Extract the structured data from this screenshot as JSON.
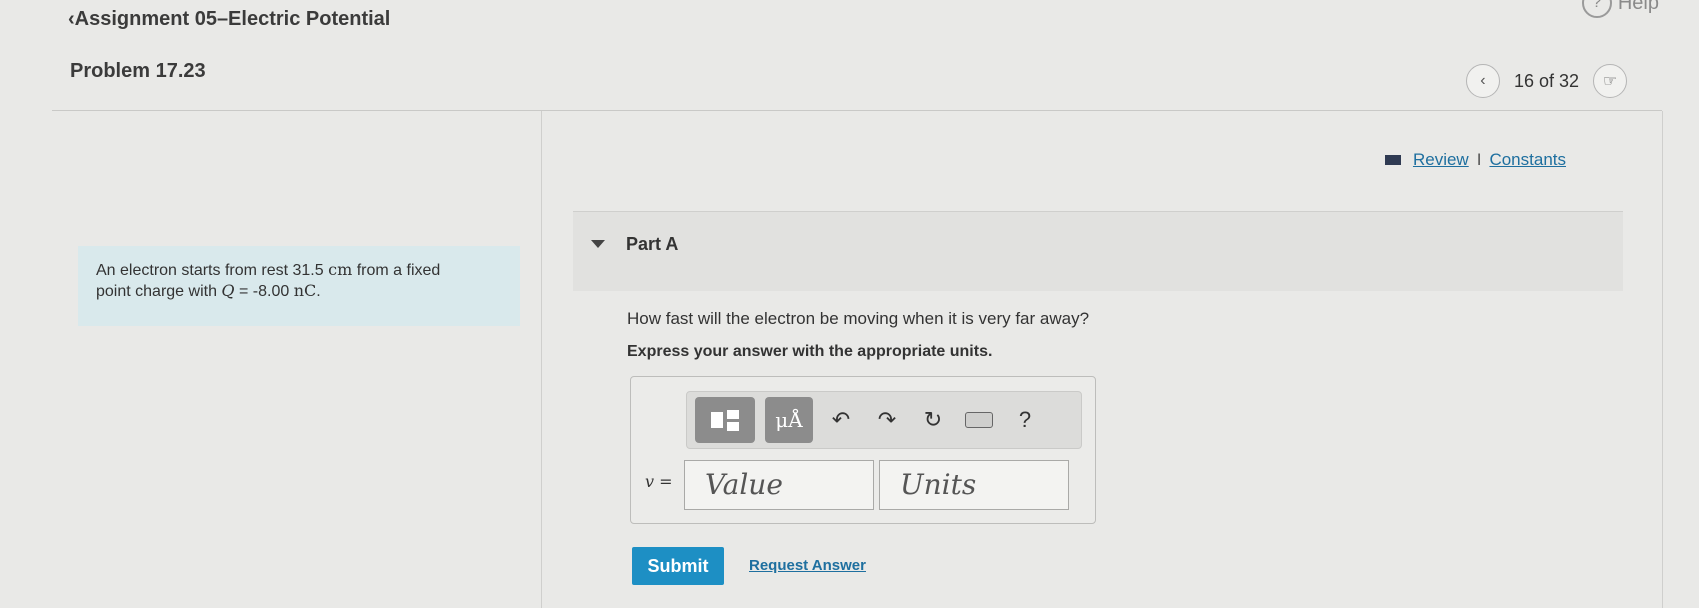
{
  "header": {
    "back_label": "Assignment 05–Electric Potential",
    "help_label": "Help",
    "problem_title": "Problem 17.23",
    "pager_text": "16 of 32"
  },
  "problem": {
    "text_1": "An electron starts from rest 31.5",
    "unit_1": "cm",
    "text_2": "from a fixed",
    "text_3": "point charge with",
    "math_var": "Q",
    "math_eq": " = -8.00 ",
    "unit_2": "nC",
    "text_4": "."
  },
  "links": {
    "review": "Review",
    "separator": "I",
    "constants": "Constants"
  },
  "part": {
    "label": "Part A",
    "question": "How fast will the electron be moving when it is very far away?",
    "instruction": "Express your answer with the appropriate units."
  },
  "toolbar": {
    "units_label": "μÅ",
    "help_label": "?"
  },
  "answer": {
    "var_label": "v =",
    "value_placeholder": "Value",
    "units_placeholder": "Units"
  },
  "actions": {
    "submit": "Submit",
    "request_answer": "Request Answer"
  }
}
